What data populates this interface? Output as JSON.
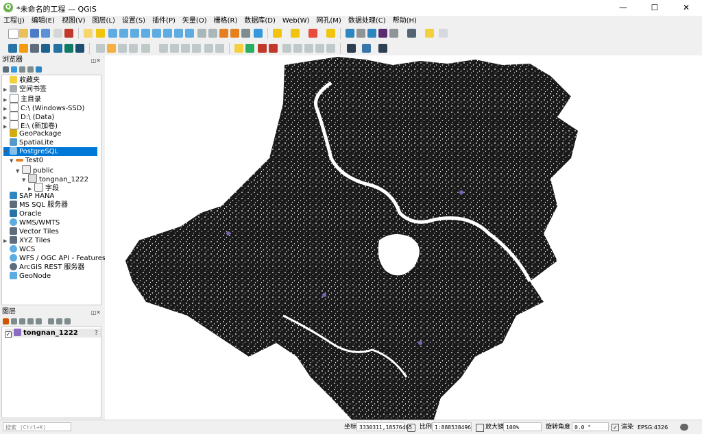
{
  "window": {
    "title": "*未命名的工程 — QGIS",
    "logo_letter": "Q"
  },
  "controls": {
    "minimize": "—",
    "maximize": "☐",
    "close": "✕"
  },
  "menu": [
    "工程(J)",
    "编辑(E)",
    "视图(V)",
    "图层(L)",
    "设置(S)",
    "插件(P)",
    "矢量(O)",
    "栅格(R)",
    "数据库(D)",
    "Web(W)",
    "网孔(M)",
    "数据处理(C)",
    "帮助(H)"
  ],
  "browser": {
    "title": "浏览器",
    "items": [
      {
        "label": "收藏夹",
        "icon": "star-icon"
      },
      {
        "label": "空间书签",
        "icon": "bookmark-icon"
      },
      {
        "label": "主目录",
        "icon": "home-folder-icon"
      },
      {
        "label": "C:\\ (Windows-SSD)",
        "icon": "folder-icon"
      },
      {
        "label": "D:\\ (Data)",
        "icon": "folder-icon"
      },
      {
        "label": "E:\\ (新加卷)",
        "icon": "folder-icon"
      },
      {
        "label": "GeoPackage",
        "icon": "geopackage-icon"
      },
      {
        "label": "SpatiaLite",
        "icon": "spatialite-icon"
      },
      {
        "label": "PostgreSQL",
        "icon": "postgresql-icon"
      },
      {
        "label": "Test0",
        "icon": "connection-icon"
      },
      {
        "label": "public",
        "icon": "schema-icon"
      },
      {
        "label": "tongnan_1222",
        "icon": "polygon-table-icon"
      },
      {
        "label": "字段",
        "icon": "fields-icon"
      },
      {
        "label": "SAP HANA",
        "icon": "sap-hana-icon"
      },
      {
        "label": "MS SQL 服务器",
        "icon": "mssql-icon"
      },
      {
        "label": "Oracle",
        "icon": "oracle-icon"
      },
      {
        "label": "WMS/WMTS",
        "icon": "wms-icon"
      },
      {
        "label": "Vector Tiles",
        "icon": "vector-tiles-icon"
      },
      {
        "label": "XYZ Tiles",
        "icon": "xyz-tiles-icon"
      },
      {
        "label": "WCS",
        "icon": "wcs-icon"
      },
      {
        "label": "WFS / OGC API - Features",
        "icon": "wfs-icon"
      },
      {
        "label": "ArcGIS REST 服务器",
        "icon": "arcgis-icon"
      },
      {
        "label": "GeoNode",
        "icon": "geonode-icon"
      }
    ]
  },
  "layers": {
    "title": "图层",
    "items": [
      {
        "label": "tongnan_1222",
        "checked": true,
        "color": "#8c6bc1"
      }
    ]
  },
  "map": {
    "fill_color": "#1a1a1a",
    "feature_color": "#7a60b5"
  },
  "status": {
    "search_placeholder": "搜索 (Ctrl+K)",
    "coord_label": "坐标",
    "coord_value": "3330311,18576465",
    "scale_label": "比例",
    "scale_value": "1:888538496",
    "magnifier_label": "放大镜",
    "magnifier_value": "100%",
    "rotation_label": "旋转角度",
    "rotation_value": "0.0 °",
    "render_label": "渲染",
    "crs_label": "EPSG:4326"
  }
}
